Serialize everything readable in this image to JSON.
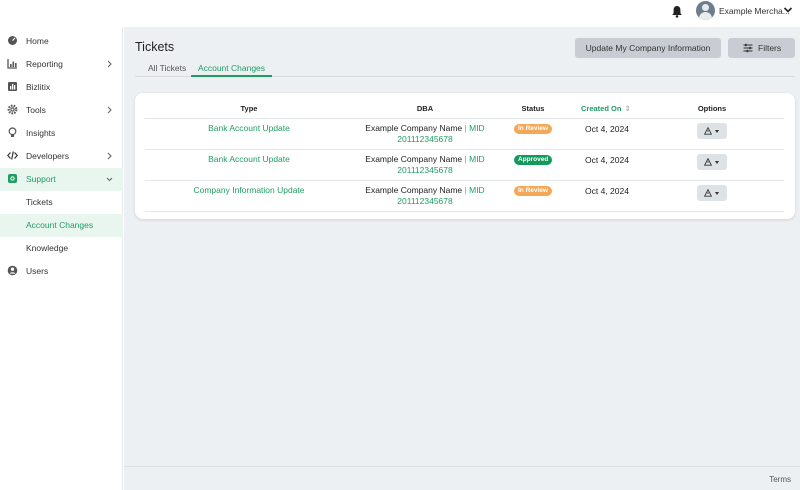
{
  "user": {
    "name": "Example Mercha..."
  },
  "sidebar": {
    "items": [
      {
        "label": "Home",
        "icon": "gauge-icon"
      },
      {
        "label": "Reporting",
        "icon": "chart-icon"
      },
      {
        "label": "Bizlitix",
        "icon": "bizlitix-icon"
      },
      {
        "label": "Tools",
        "icon": "gear-icon"
      },
      {
        "label": "Insights",
        "icon": "lightbulb-icon"
      },
      {
        "label": "Developers",
        "icon": "code-icon"
      },
      {
        "label": "Support",
        "icon": "support-icon"
      },
      {
        "label": "Tickets"
      },
      {
        "label": "Account Changes"
      },
      {
        "label": "Knowledge"
      },
      {
        "label": "Users",
        "icon": "user-icon"
      }
    ]
  },
  "page": {
    "title": "Tickets",
    "update_button": "Update My Company Information",
    "filters_button": "Filters",
    "tabs": [
      {
        "label": "All Tickets"
      },
      {
        "label": "Account Changes"
      }
    ]
  },
  "table": {
    "headers": {
      "type": "Type",
      "dba": "DBA",
      "status": "Status",
      "created": "Created On",
      "options": "Options"
    },
    "rows": [
      {
        "type": "Bank Account Update",
        "company": "Example Company Name",
        "sep": "|",
        "mid": "MID",
        "mid_number": "201112345678",
        "status": "In Review",
        "date": "Oct 4, 2024"
      },
      {
        "type": "Bank Account Update",
        "company": "Example Company Name",
        "sep": "|",
        "mid": "MID",
        "mid_number": "201112345678",
        "status": "Approved",
        "date": "Oct 4, 2024"
      },
      {
        "type": "Company Information Update",
        "company": "Example Company Name",
        "sep": "|",
        "mid": "MID",
        "mid_number": "201112345678",
        "status": "In Review",
        "date": "Oct 4, 2024"
      }
    ]
  },
  "footer": {
    "terms": "Terms"
  },
  "colors": {
    "accent": "#1f9d63",
    "review": "#f5a758",
    "approved": "#139a5a",
    "background": "#edf0f3"
  }
}
